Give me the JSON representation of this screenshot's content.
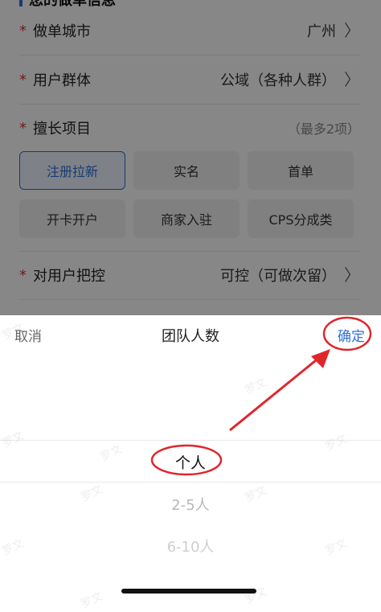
{
  "form": {
    "section_title": "您的做单信息",
    "rows": [
      {
        "label": "做单城市",
        "value": "广州"
      },
      {
        "label": "用户群体",
        "value": "公域（各种人群）"
      },
      {
        "label": "擅长项目",
        "hint": "（最多2项）"
      },
      {
        "label": "对用户把控",
        "value": "可控（可做次留）"
      }
    ],
    "required_mark": "*",
    "chevron": "〉",
    "tags": [
      "注册拉新",
      "实名",
      "首单",
      "开卡开户",
      "商家入驻",
      "CPS分成类"
    ],
    "selected_tag": "注册拉新"
  },
  "picker": {
    "cancel_label": "取消",
    "title": "团队人数",
    "confirm_label": "确定",
    "options": [
      "个人",
      "2-5人",
      "6-10人"
    ],
    "selected": "个人"
  },
  "watermark": "罗文",
  "colors": {
    "accent": "#2f6fd6",
    "required": "#e0302a",
    "annotation": "#e0262b"
  }
}
